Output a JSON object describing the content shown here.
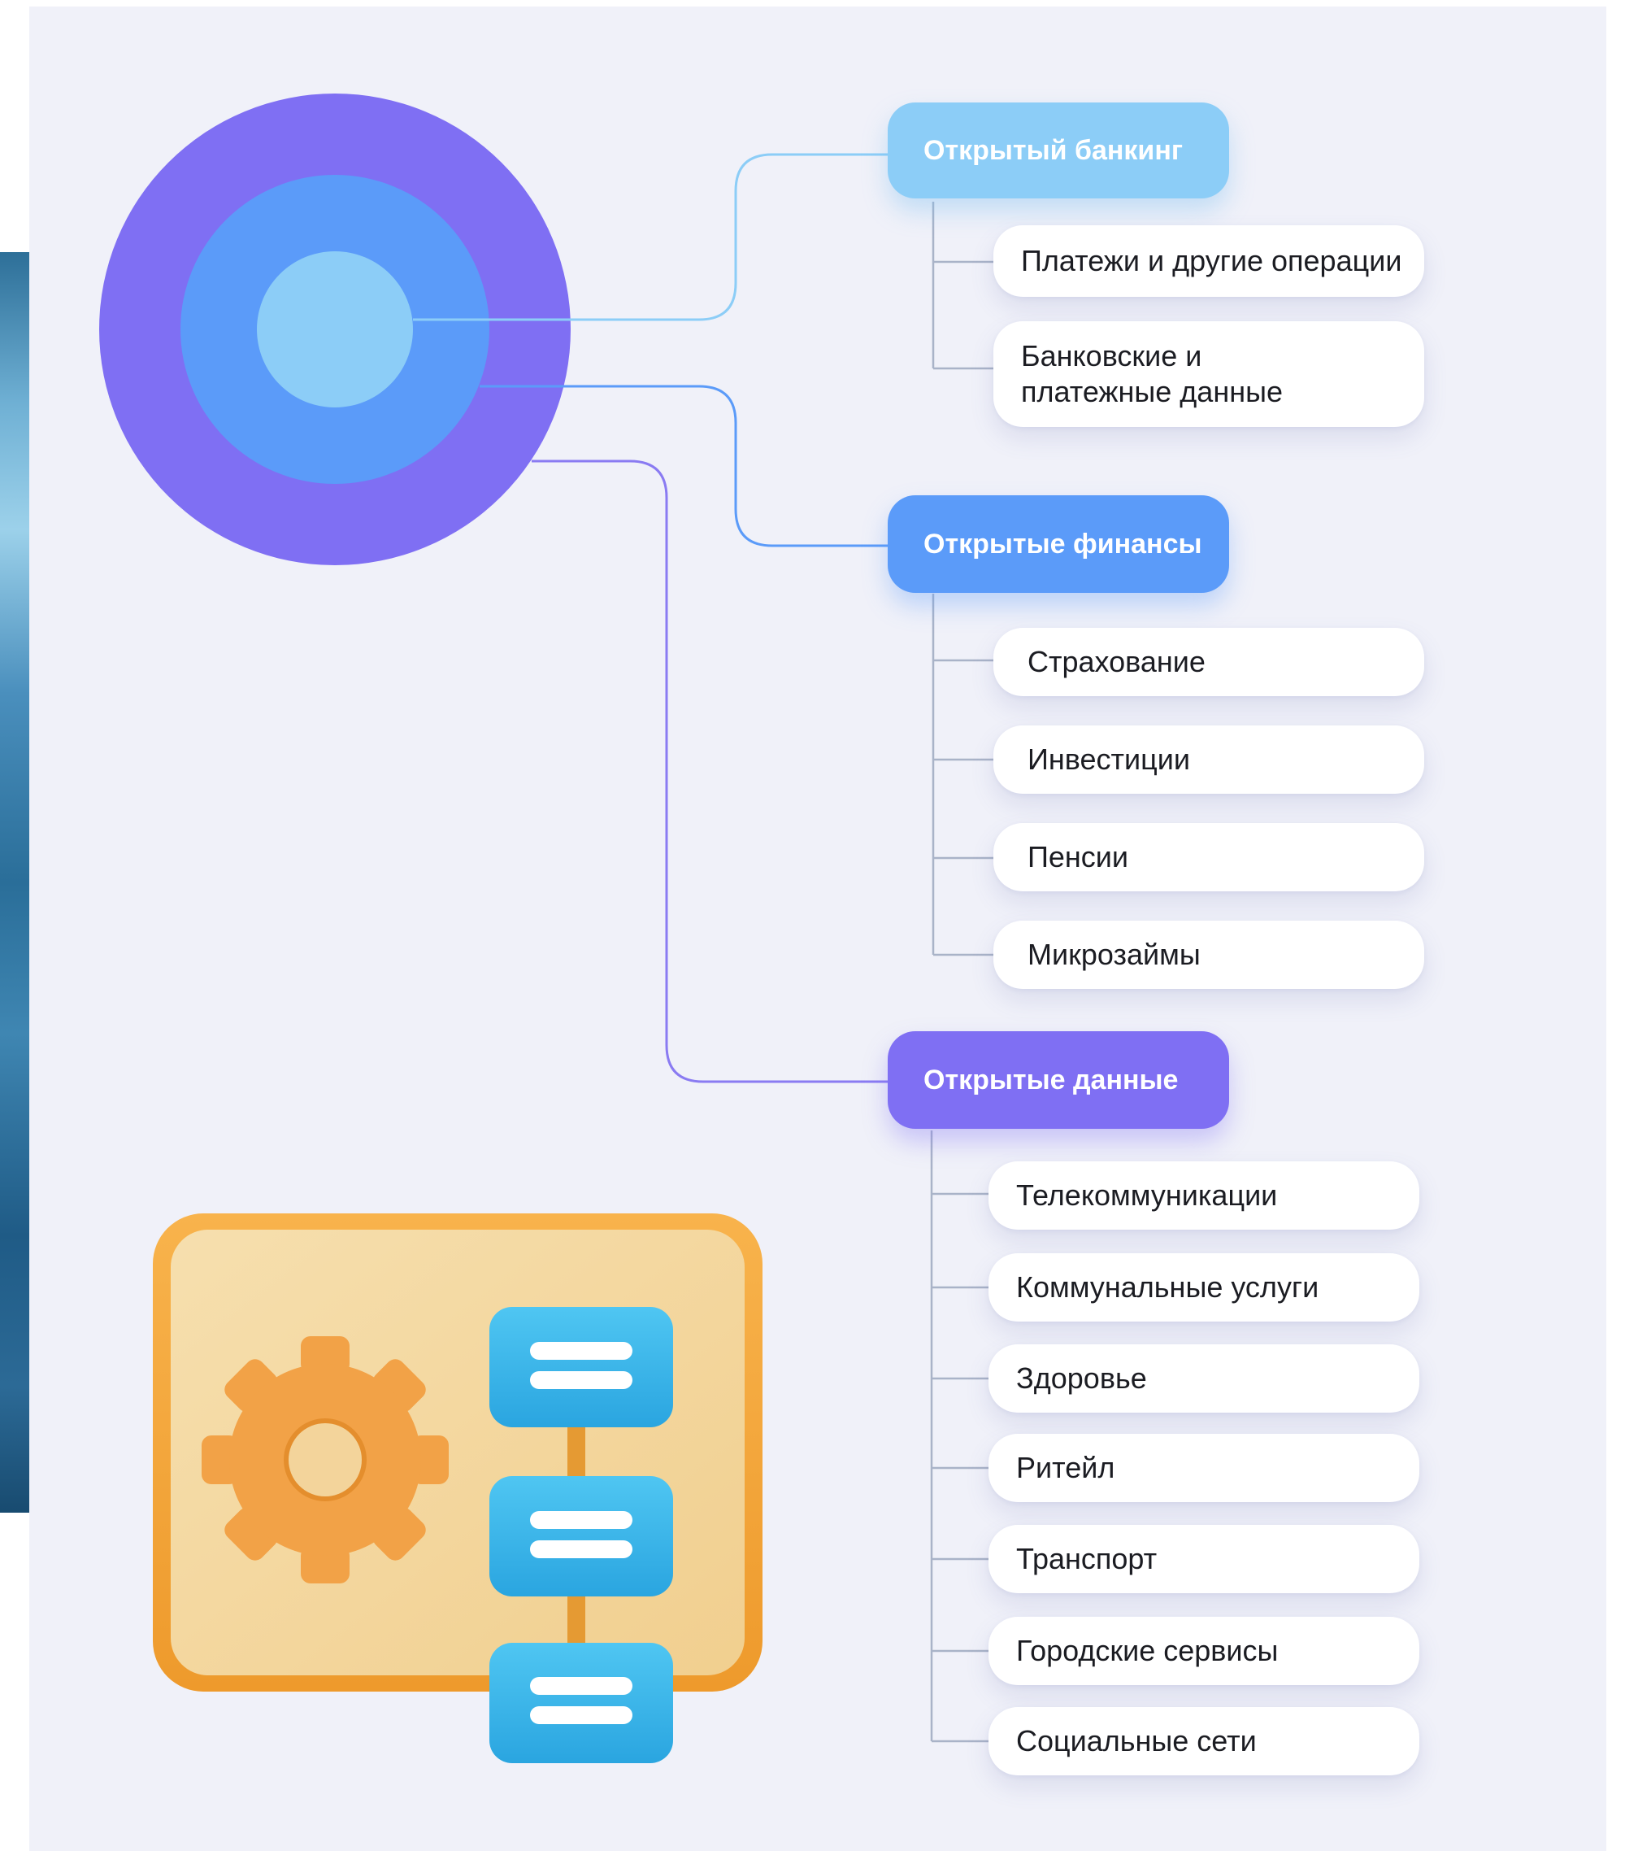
{
  "colors": {
    "outer_ring": "#7f6ff3",
    "middle_ring": "#5b9bf9",
    "inner_circle": "#8ccdf7",
    "line_banking": "#8ccdf7",
    "line_finance": "#5b9bf9",
    "line_data": "#8a7bf2",
    "illustration_frame": "#f3a23b",
    "illustration_board": "#f4d8a0",
    "illustration_cards": "#36b8ec"
  },
  "illustration": {
    "icons": [
      "gear-icon",
      "list-card-icon"
    ]
  },
  "categories": [
    {
      "label": "Открытый банкинг",
      "color": "#8ccdf7",
      "items": [
        "Платежи и другие операции",
        "Банковские и платежные данные"
      ]
    },
    {
      "label": "Открытые финансы",
      "color": "#5b9bf9",
      "items": [
        "Страхование",
        "Инвестиции",
        "Пенсии",
        "Микрозаймы"
      ]
    },
    {
      "label": "Открытые данные",
      "color": "#7f6ff3",
      "items": [
        "Телекоммуникации",
        "Коммунальные услуги",
        "Здоровье",
        "Ритейл",
        "Транспорт",
        "Городские сервисы",
        "Социальные сети"
      ]
    }
  ]
}
